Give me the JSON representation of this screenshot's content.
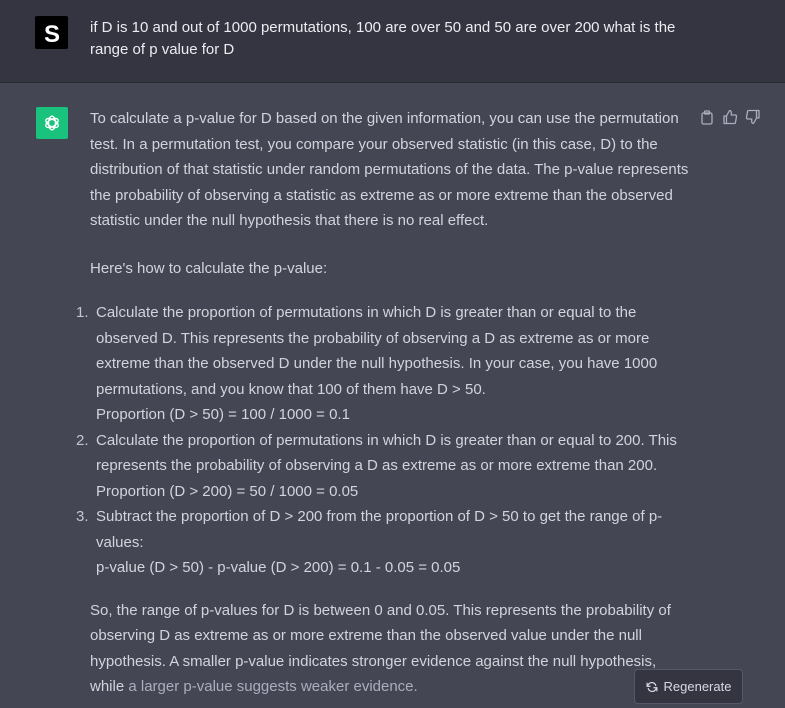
{
  "user_message": {
    "avatar_letter": "S",
    "text": "if D is 10 and out of 1000 permutations, 100 are over 50 and 50 are over 200 what is the range of p value for D"
  },
  "assistant_message": {
    "avatar_icon": "openai-logo-icon",
    "avatar_color": "#19c37d",
    "paragraph_1": "To calculate a p-value for D based on the given information, you can use the permutation test. In a permutation test, you compare your observed statistic (in this case, D) to the distribution of that statistic under random permutations of the data. The p-value represents the probability of observing a statistic as extreme as or more extreme than the observed statistic under the null hypothesis that there is no real effect.",
    "paragraph_2": "Here's how to calculate the p-value:",
    "steps": [
      {
        "number": "1.",
        "text": "Calculate the proportion of permutations in which D is greater than or equal to the observed D. This represents the probability of observing a D as extreme as or more extreme than the observed D under the null hypothesis. In your case, you have 1000 permutations, and you know that 100 of them have D > 50.",
        "formula": "Proportion (D > 50) = 100 / 1000 = 0.1"
      },
      {
        "number": "2.",
        "text": "Calculate the proportion of permutations in which D is greater than or equal to 200. This represents the probability of observing a D as extreme as or more extreme than 200.",
        "formula": "Proportion (D > 200) = 50 / 1000 = 0.05"
      },
      {
        "number": "3.",
        "text": "Subtract the proportion of D > 200 from the proportion of D > 50 to get the range of p-values:",
        "formula": "p-value (D > 50) - p-value (D > 200) = 0.1 - 0.05 = 0.05"
      }
    ],
    "paragraph_3_main": "So, the range of p-values for D is between 0 and 0.05. This represents the probability of observing D as extreme as or more extreme than the observed value under the null hypothesis. A smaller p-value indicates stronger evidence against the null hypothesis, while",
    "paragraph_3_faded": "a larger p-value suggests weaker evidence."
  },
  "actions": {
    "copy_icon": "clipboard-icon",
    "like_icon": "thumbs-up-icon",
    "dislike_icon": "thumbs-down-icon"
  },
  "regenerate_button": {
    "icon": "refresh-icon",
    "label": "Regenerate"
  },
  "colors": {
    "user_bg": "#343541",
    "assistant_bg": "#444654",
    "accent": "#19c37d"
  }
}
